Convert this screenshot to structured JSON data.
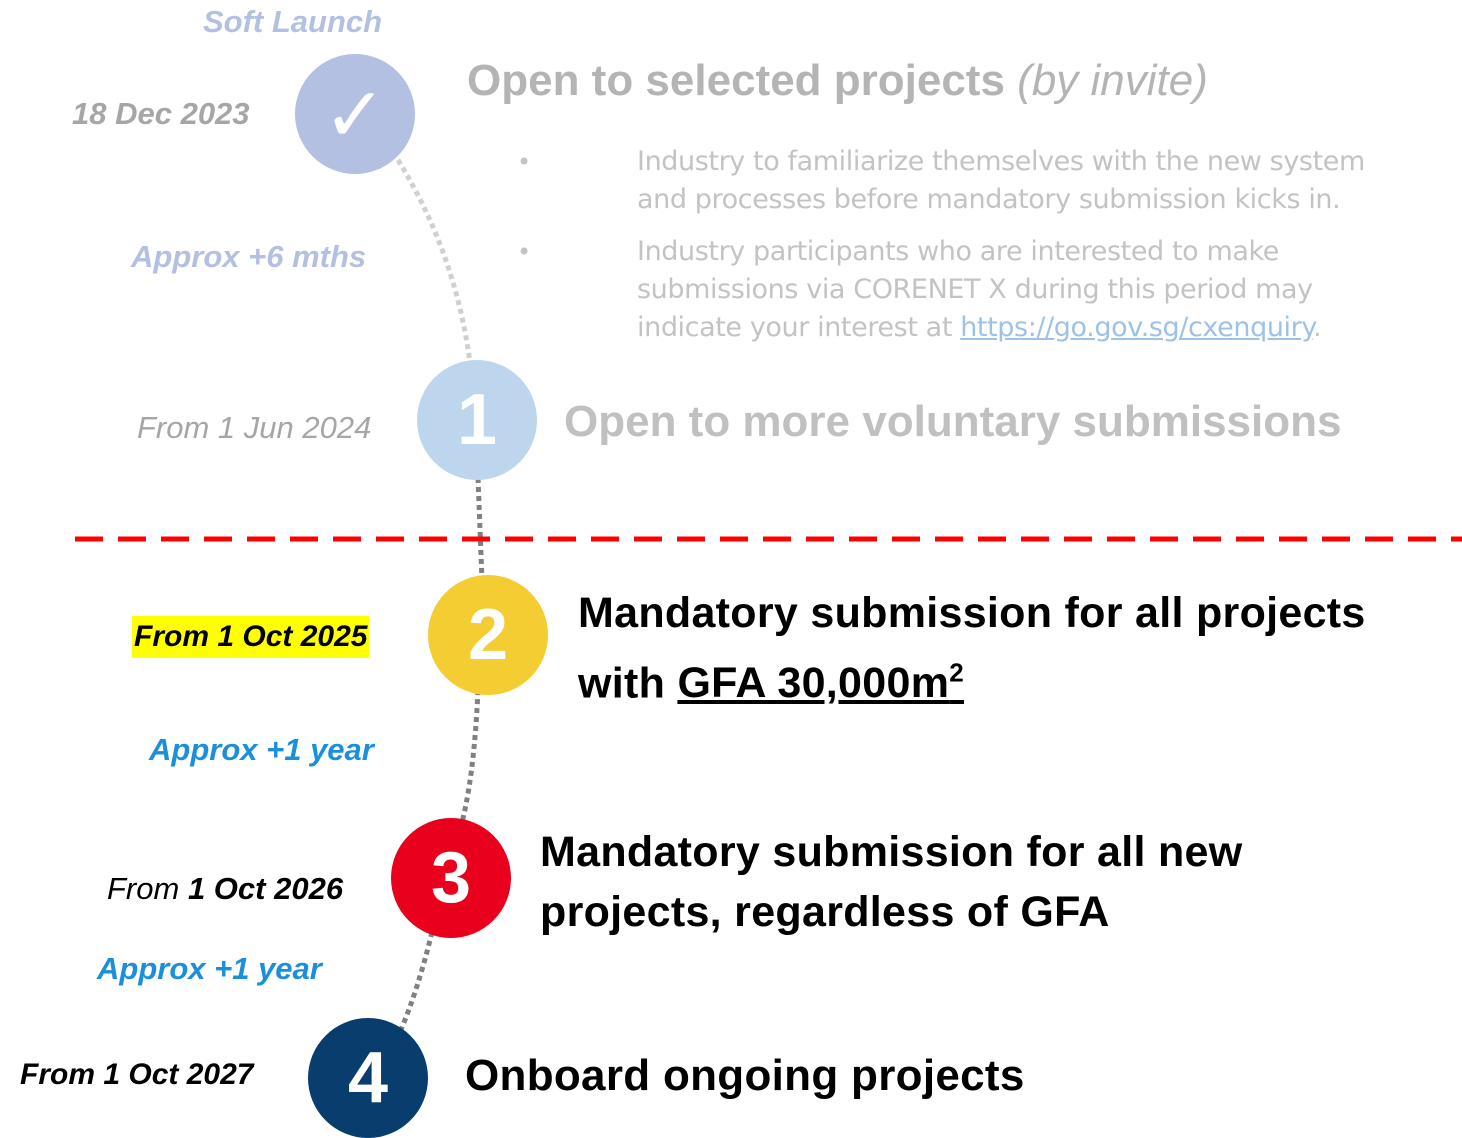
{
  "soft_launch": {
    "label": "Soft Launch",
    "date": "18 Dec 2023",
    "marker_icon": "check-icon",
    "marker_glyph": "✓",
    "title": "Open to selected projects",
    "title_note": "(by invite)",
    "bullets": [
      "Industry to familiarize themselves with the new system and processes before mandatory submission kicks in.",
      "Industry participants who are interested to make submissions via CORENET X during this period may indicate your interest at"
    ],
    "link_text": "https://go.gov.sg/cxenquiry",
    "link_suffix": "."
  },
  "gap_1": "Approx +6 mths",
  "stage_1": {
    "number": "1",
    "date": "From 1 Jun 2024",
    "title": "Open to more voluntary submissions"
  },
  "stage_2": {
    "number": "2",
    "date": "From 1 Oct 2025",
    "title_line1": "Mandatory submission for all projects",
    "title_line2_prefix": "with",
    "title_gfa": "GFA 30,000m",
    "title_gfa_sup": "2"
  },
  "gap_2": "Approx +1 year",
  "stage_3": {
    "number": "3",
    "date_prefix": "From",
    "date": "1 Oct 2026",
    "title_line1": "Mandatory submission for all new",
    "title_line2": "projects, regardless of GFA"
  },
  "gap_3": "Approx +1 year",
  "stage_4": {
    "number": "4",
    "date": "From 1 Oct 2027",
    "title": "Onboard ongoing projects"
  },
  "colors": {
    "soft_launch": "#b4c0e2",
    "stage_1": "#bdd6ee",
    "stage_2": "#f4cd33",
    "stage_3": "#e8001c",
    "stage_4": "#083d6e",
    "divider": "#ff0000",
    "gap_active": "#1c8fdc",
    "gap_faded": "#b4c0e2",
    "highlight": "#ffff00"
  }
}
